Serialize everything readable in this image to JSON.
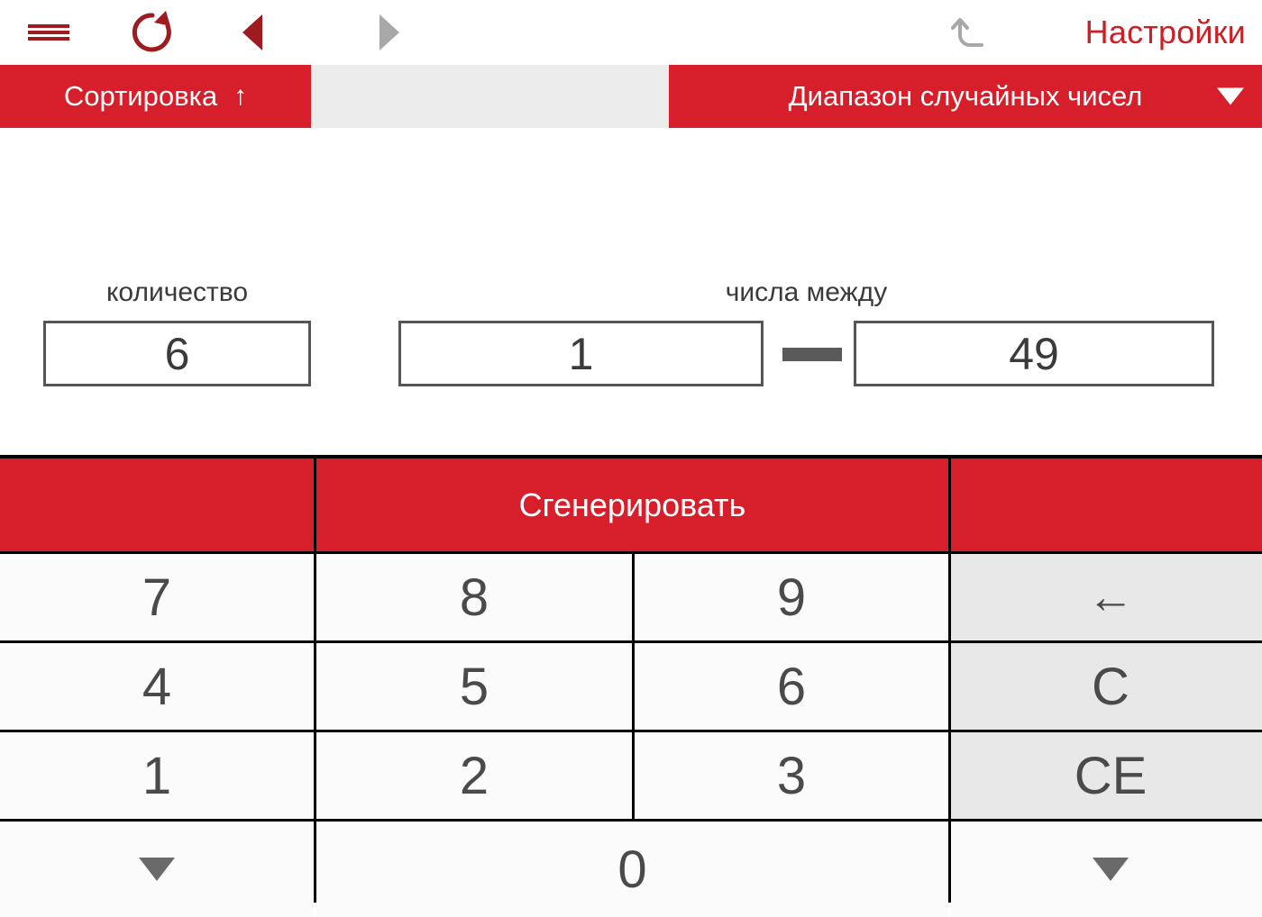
{
  "toolbar": {
    "menu_icon": "hamburger-icon",
    "reload_icon": "reload-icon",
    "back_icon": "nav-back-icon",
    "forward_icon": "nav-forward-icon",
    "undo_icon": "undo-icon",
    "settings_label": "Настройки",
    "accent_red": "#cc2027",
    "icon_active_color": "#9e1b20",
    "icon_disabled_color": "#a8a8a8"
  },
  "modebar": {
    "sort_label": "Сортировка",
    "sort_arrow": "↑",
    "range_label": "Диапазон случайных чисел",
    "dropdown_icon": "chevron-down-icon",
    "bar_color": "#d61f2b",
    "gap_color": "#ececec"
  },
  "fields": {
    "count_label": "количество",
    "count_value": "6",
    "between_label": "числа между",
    "min_value": "1",
    "separator": "—",
    "max_value": "49"
  },
  "keypad": {
    "generate_label": "Сгенерировать",
    "keys": {
      "k7": "7",
      "k8": "8",
      "k9": "9",
      "k4": "4",
      "k5": "5",
      "k6": "6",
      "k1": "1",
      "k2": "2",
      "k3": "3",
      "k0": "0",
      "backspace": "←",
      "clear": "C",
      "clear_entry": "CE",
      "scroll_down_left": "▼",
      "scroll_down_right": "▼"
    },
    "key_bg": "#fbfbfb",
    "func_key_bg": "#e8e8e8",
    "red_bg": "#d61f2b"
  }
}
